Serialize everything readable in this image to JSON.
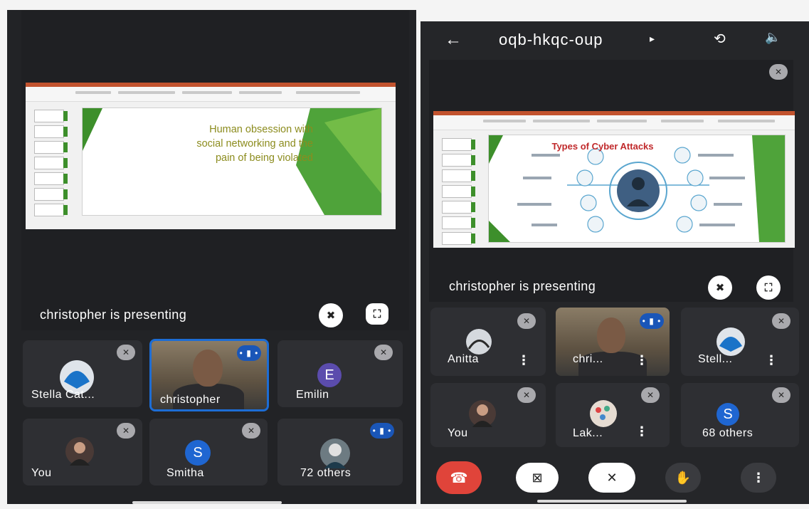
{
  "left_screen": {
    "slide": {
      "title_lines": [
        "Human obsession with",
        "social networking and the",
        "pain of being violated"
      ],
      "colors": {
        "ribbon_accent": "#c2532e",
        "slide_green": "#3d8f2b",
        "title_color": "#8c8c1e"
      }
    },
    "presenting_label": "christopher is presenting",
    "icons": {
      "unpin": "pin-off-icon",
      "fullscreen": "fullscreen-icon"
    },
    "participants": [
      {
        "name": "Stella Cat...",
        "muted": true
      },
      {
        "name": "christopher",
        "speaking": true,
        "active": true
      },
      {
        "name": "Emilin",
        "initial": "E",
        "avatar_color": "#5b4cad",
        "muted": true
      },
      {
        "name": "You",
        "muted": true
      },
      {
        "name": "Smitha",
        "initial": "S",
        "avatar_color": "#1f66d1",
        "muted": true
      },
      {
        "name": "72 others",
        "speaking": true
      }
    ]
  },
  "right_screen": {
    "meeting_code": "oqb-hkqc-oup",
    "code_arrow": "▸",
    "slide": {
      "title": "Types of Cyber Attacks",
      "colors": {
        "title_red": "#c0292b",
        "hub_blue": "#5aa6cf"
      }
    },
    "presenting_label": "christopher is presenting",
    "participants": [
      {
        "name": "Anitta",
        "muted": true
      },
      {
        "name": "chri...",
        "speaking": true
      },
      {
        "name": "Stell...",
        "muted": true
      },
      {
        "name": "You",
        "muted": true
      },
      {
        "name": "Lak...",
        "muted": true
      },
      {
        "name": "68 others",
        "initial": "S",
        "avatar_color": "#1f66d1",
        "muted": true
      }
    ],
    "controls": {
      "end_call_color": "#e0443a",
      "icons": [
        "end-call-icon",
        "camera-off-icon",
        "mic-off-icon",
        "raise-hand-icon",
        "more-options-icon"
      ]
    }
  }
}
